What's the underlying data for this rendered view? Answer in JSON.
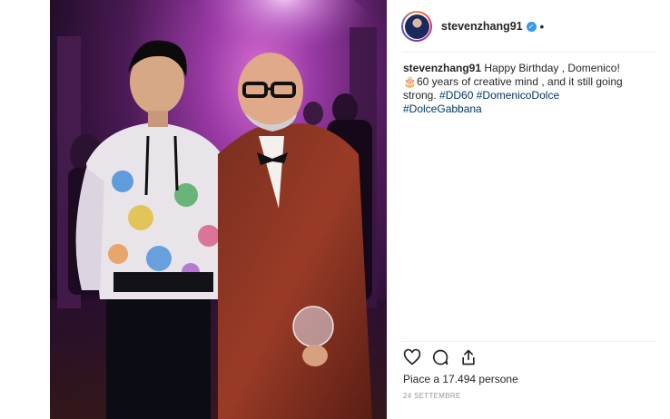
{
  "post": {
    "username": "stevenzhang91",
    "more_glyph": "•",
    "caption_user": "stevenzhang91",
    "caption_text_1": "Happy Birthday , Domenico!",
    "caption_emoji": "🎂",
    "caption_text_2": "60 years of creative mind , and it still going strong.",
    "hashtags": [
      "#DD60",
      "#DomenicoDolce",
      "#DolceGabbana"
    ],
    "likes": "Piace a 17.494 persone",
    "date": "24 SETTEMBRE"
  },
  "icons": {
    "verified": "verified-badge-icon",
    "like": "heart-icon",
    "comment": "comment-icon",
    "share": "share-icon"
  },
  "colors": {
    "link": "#003569",
    "verified": "#3897f0",
    "text": "#262626",
    "muted": "#999999"
  }
}
